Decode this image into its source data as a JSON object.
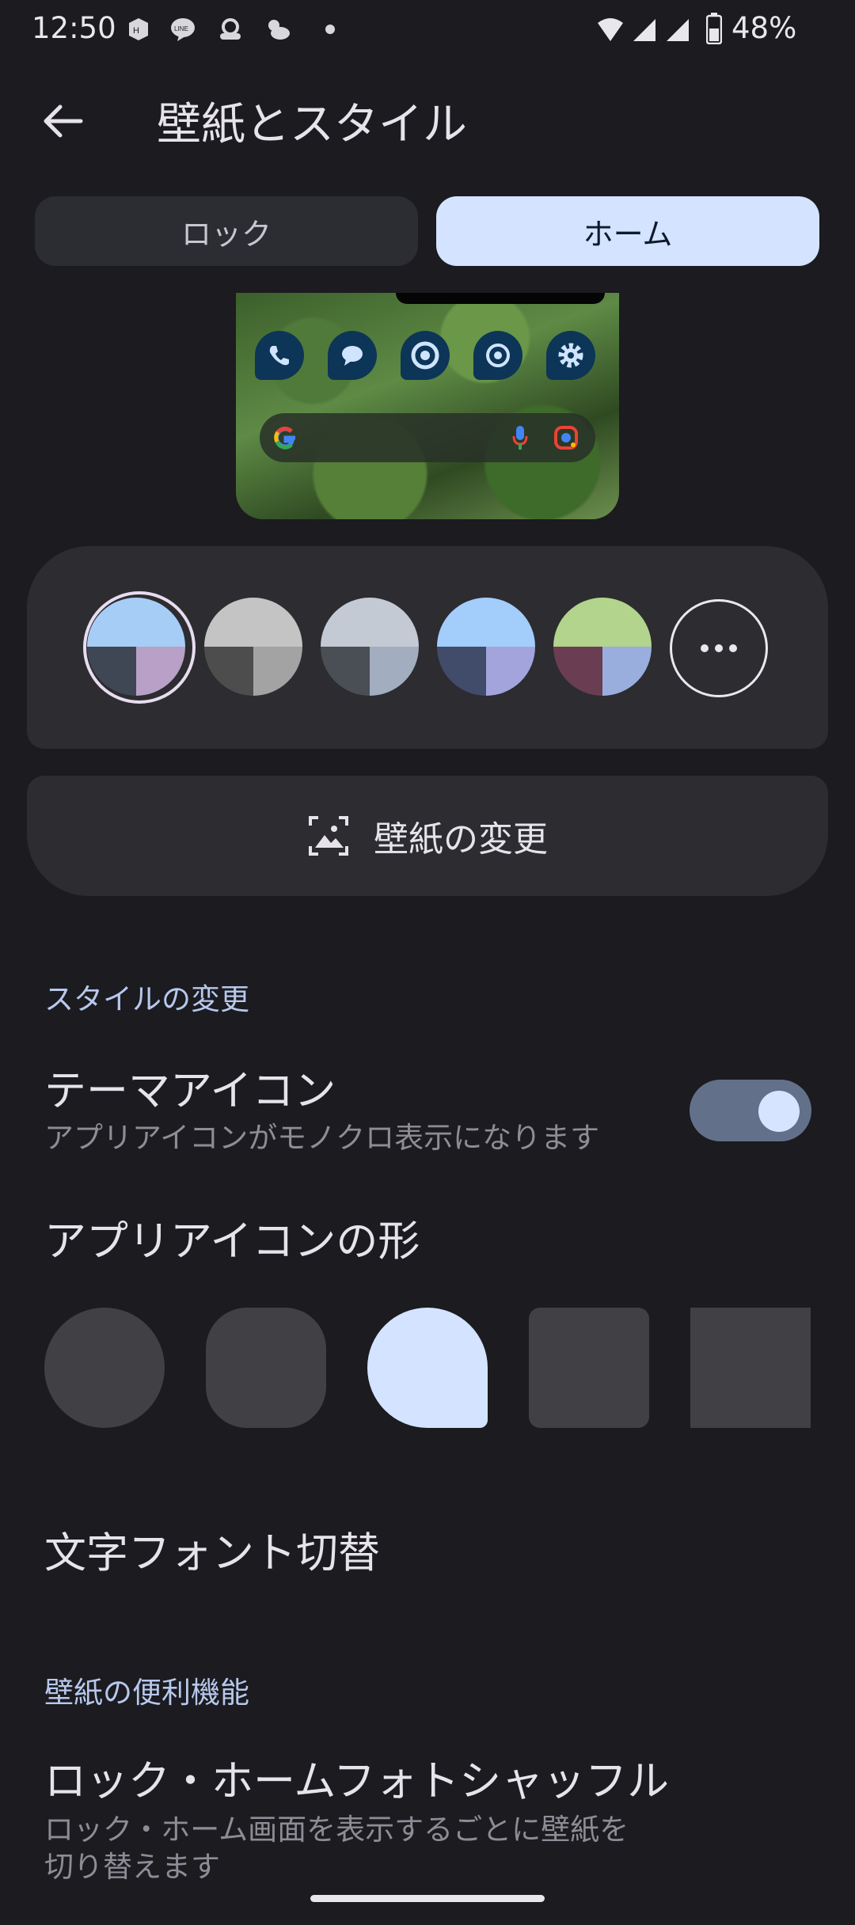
{
  "status_bar": {
    "time": "12:50",
    "battery": "48%",
    "icons": [
      "notification-icon",
      "line-icon",
      "amazon-icon",
      "weather-icon",
      "dot-icon",
      "wifi-icon",
      "signal-icon",
      "signal-icon-2",
      "battery-icon"
    ]
  },
  "app_bar": {
    "title": "壁紙とスタイル"
  },
  "tabs": [
    {
      "label": "ロック",
      "selected": false
    },
    {
      "label": "ホーム",
      "selected": true
    }
  ],
  "palette": {
    "swatches": [
      {
        "top": "#a6cdf6",
        "bottom_left": "#3f4654",
        "bottom_right": "#b8a0c6",
        "selected": true
      },
      {
        "top": "#c4c4c4",
        "bottom_left": "#4d4d4d",
        "bottom_right": "#a3a3a3",
        "selected": false
      },
      {
        "top": "#c4cad4",
        "bottom_left": "#4a4e55",
        "bottom_right": "#a2aec0",
        "selected": false
      },
      {
        "top": "#a3cdfa",
        "bottom_left": "#414b6a",
        "bottom_right": "#a3a4dc",
        "selected": false
      },
      {
        "top": "#b2d48c",
        "bottom_left": "#6b3d52",
        "bottom_right": "#9aaede",
        "selected": false
      }
    ]
  },
  "change_wallpaper": {
    "label": "壁紙の変更"
  },
  "style_section": {
    "header": "スタイルの変更",
    "themed_icons": {
      "title": "テーマアイコン",
      "subtitle": "アプリアイコンがモノクロ表示になります",
      "enabled": true
    },
    "icon_shape": {
      "title": "アプリアイコンの形",
      "selected_index": 2
    },
    "font": {
      "title": "文字フォント切替"
    }
  },
  "wallpaper_section": {
    "header": "壁紙の便利機能",
    "shuffle": {
      "title": "ロック・ホームフォトシャッフル",
      "subtitle_line1": "ロック・ホーム画面を表示するごとに壁紙を",
      "subtitle_line2": "切り替えます"
    }
  },
  "colors": {
    "background": "#1b1b20",
    "accent": "#d4e3ff",
    "card": "#2c2c31"
  }
}
